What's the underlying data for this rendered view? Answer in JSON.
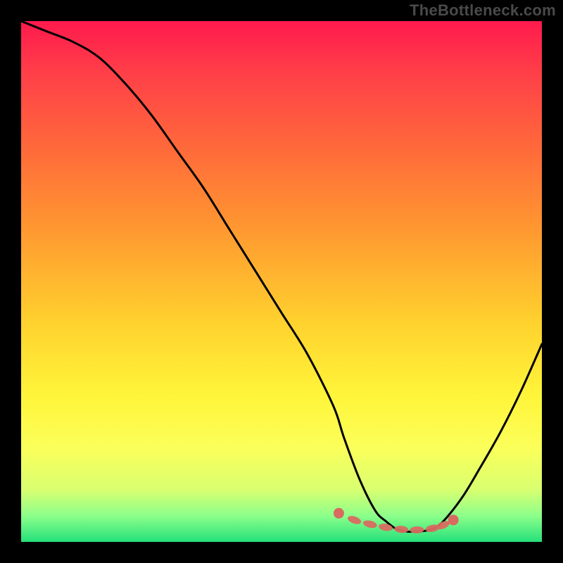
{
  "watermark": "TheBottleneck.com",
  "chart_data": {
    "type": "line",
    "title": "",
    "xlabel": "",
    "ylabel": "",
    "xlim": [
      0,
      100
    ],
    "ylim": [
      0,
      100
    ],
    "grid": false,
    "legend": false,
    "series": [
      {
        "name": "bottleneck-curve",
        "x": [
          0,
          5,
          10,
          15,
          20,
          25,
          30,
          35,
          40,
          45,
          50,
          55,
          60,
          62,
          65,
          68,
          70,
          72,
          74,
          76,
          78,
          80,
          82,
          85,
          88,
          92,
          96,
          100
        ],
        "values": [
          100,
          98,
          96,
          93,
          88,
          82,
          75,
          68,
          60,
          52,
          44,
          36,
          26,
          20,
          12,
          6,
          4,
          2.5,
          2,
          2,
          2.2,
          3,
          5,
          9,
          14,
          21,
          29,
          38
        ]
      }
    ],
    "markers": {
      "name": "highlight-range",
      "x": [
        61,
        64,
        67,
        70,
        73,
        76,
        79,
        81,
        83
      ],
      "values": [
        5.5,
        4.2,
        3.4,
        2.8,
        2.4,
        2.3,
        2.6,
        3.2,
        4.2
      ]
    },
    "gradient_stops": [
      {
        "pct": 0,
        "color": "#ff1a4d"
      },
      {
        "pct": 10,
        "color": "#ff3f48"
      },
      {
        "pct": 25,
        "color": "#ff6b3a"
      },
      {
        "pct": 40,
        "color": "#ff9830"
      },
      {
        "pct": 58,
        "color": "#ffd22e"
      },
      {
        "pct": 72,
        "color": "#fff53a"
      },
      {
        "pct": 82,
        "color": "#fbff5a"
      },
      {
        "pct": 90,
        "color": "#d8ff70"
      },
      {
        "pct": 95,
        "color": "#8cff8a"
      },
      {
        "pct": 100,
        "color": "#25e07a"
      }
    ]
  }
}
